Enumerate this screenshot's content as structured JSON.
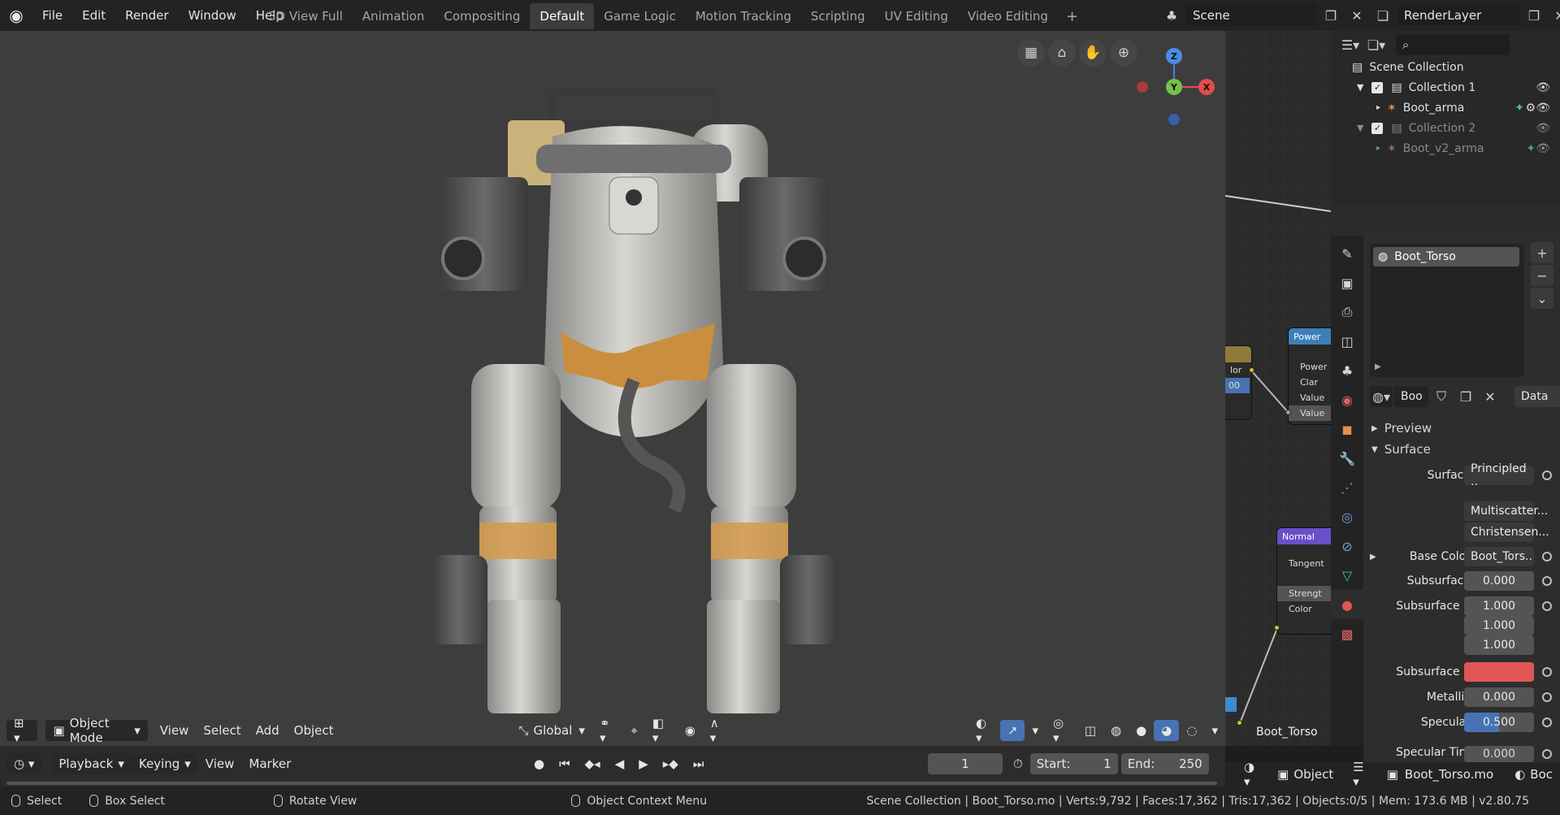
{
  "menu": {
    "items": [
      "File",
      "Edit",
      "Render",
      "Window",
      "Help"
    ]
  },
  "workspaces": {
    "tabs": [
      "3D View Full",
      "Animation",
      "Compositing",
      "Default",
      "Game Logic",
      "Motion Tracking",
      "Scripting",
      "UV Editing",
      "Video Editing"
    ],
    "active": "Default"
  },
  "scene": {
    "name": "Scene",
    "view_layer": "RenderLayer"
  },
  "viewport": {
    "mode": "Object Mode",
    "menus": [
      "View",
      "Select",
      "Add",
      "Object"
    ],
    "orientation": "Global",
    "axes": {
      "z": "Z",
      "y": "Y",
      "x": "X"
    }
  },
  "timeline": {
    "menus": [
      "Playback",
      "Keying",
      "View",
      "Marker"
    ],
    "current_frame": "1",
    "start_label": "Start:",
    "start": "1",
    "end_label": "End:",
    "end": "250"
  },
  "outliner": {
    "root": "Scene Collection",
    "items": [
      {
        "label": "Collection 1"
      },
      {
        "label": "Boot_arma"
      },
      {
        "label": "Collection 2"
      },
      {
        "label": "Boot_v2_arma"
      }
    ]
  },
  "node_editor": {
    "power_node": {
      "title": "Power",
      "rows": [
        "Power",
        "Clar",
        "Value",
        "Value"
      ]
    },
    "left_node_rows": [
      "lor",
      "00"
    ],
    "normal_node": {
      "title": "Normal",
      "rows": [
        "Tangent",
        "Strengt",
        "Color"
      ]
    },
    "label": "Boot_Torso"
  },
  "properties": {
    "material_slot": "Boot_Torso",
    "material_name": "Boo",
    "link": "Data",
    "sections": {
      "preview": "Preview",
      "surface": "Surface"
    },
    "surface_label": "Surface",
    "surface_value": "Principled ..",
    "dist1": "Multiscatter...",
    "dist2": "Christensen...",
    "base_color_label": "Base Color",
    "base_color_value": "Boot_Tors..",
    "subsurface_label": "Subsurface",
    "subsurface_value": "0.000",
    "subsurface_radius_label": "Subsurface ..",
    "subsurface_radius": [
      "1.000",
      "1.000",
      "1.000"
    ],
    "subsurface_color_label": "Subsurface ..",
    "subsurface_color": "#e05555",
    "metallic_label": "Metallic",
    "metallic_value": "0.000",
    "specular_label": "Specular",
    "specular_value": "0.500",
    "specular_fraction": 0.5,
    "specular_tint_label": "Specular Tint",
    "specular_tint_value": "0.000"
  },
  "bottom_right": {
    "mode": "Object",
    "material": "Boot_Torso.mo",
    "trail": "Boc"
  },
  "status": {
    "select": "Select",
    "box_select": "Box Select",
    "rotate": "Rotate View",
    "context": "Object Context Menu",
    "info": "Scene Collection | Boot_Torso.mo | Verts:9,792 | Faces:17,362 | Tris:17,362 | Objects:0/5 | Mem: 173.6 MB | v2.80.75"
  },
  "colors": {
    "accent": "#4772b3",
    "active_tab": "#3d3d3d"
  }
}
